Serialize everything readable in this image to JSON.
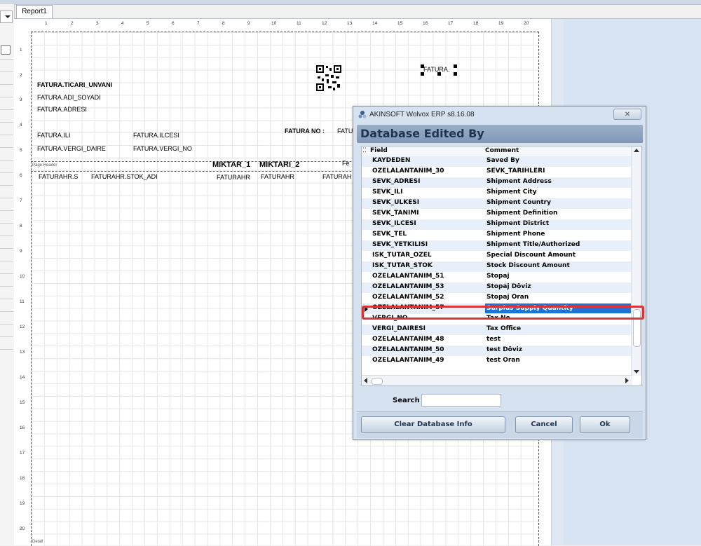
{
  "tab": {
    "label": "Report1"
  },
  "ruler": {
    "h": [
      "1",
      "2",
      "3",
      "4",
      "5",
      "6",
      "7",
      "8",
      "9",
      "10",
      "11",
      "12",
      "13",
      "14",
      "15",
      "16",
      "17",
      "18",
      "19",
      "20"
    ],
    "v": [
      "1",
      "2",
      "3",
      "4",
      "5",
      "6",
      "7",
      "8",
      "9",
      "10",
      "11",
      "12",
      "13",
      "14",
      "15",
      "16",
      "17",
      "18",
      "19",
      "20"
    ]
  },
  "report": {
    "ticari_unvani": "FATURA.TICARI_UNVANI",
    "adi_soyadi": "FATURA.ADI_SOYADI",
    "adresi": "FATURA.ADRESI",
    "ili": "FATURA.ILI",
    "ilcesi": "FATURA.ILCESI",
    "vergi_daire": "FATURA.VERGI_DAIRE",
    "vergi_no": "FATURA.VERGI_NO",
    "fatura_no_label": "FATURA NO :",
    "fatura_no_value": "FATU",
    "fatura_top": "FATURA.",
    "page_header": "Page Header",
    "miktar_1": "MIKTAR_1",
    "miktari_2": "MIKTARI_2",
    "header_cut": "Fe",
    "detail_s": "FATURAHR.S",
    "detail_stok_adi": "FATURAHR.STOK_ADI",
    "detail_3": "FATURAHR",
    "detail_4": "FATURAHR",
    "detail_5": "FATURAH",
    "detail_band": "Detail"
  },
  "dialog": {
    "title": "AKINSOFT Wolvox ERP s8.16.08",
    "close_label": "✕",
    "header": "Database Edited By",
    "columns": {
      "field": "Field",
      "comment": "Comment"
    },
    "rows": [
      {
        "field": "KAYDEDEN",
        "comment": "Saved By"
      },
      {
        "field": "OZELALANTANIM_30",
        "comment": "SEVK_TARIHLERI"
      },
      {
        "field": "SEVK_ADRESI",
        "comment": "Shipment Address"
      },
      {
        "field": "SEVK_ILI",
        "comment": "Shipment City"
      },
      {
        "field": "SEVK_ULKESI",
        "comment": "Shipment Country"
      },
      {
        "field": "SEVK_TANIMI",
        "comment": "Shipment Definition"
      },
      {
        "field": "SEVK_ILCESI",
        "comment": "Shipment District"
      },
      {
        "field": "SEVK_TEL",
        "comment": "Shipment Phone"
      },
      {
        "field": "SEVK_YETKILISI",
        "comment": "Shipment Title/Authorized"
      },
      {
        "field": "ISK_TUTAR_OZEL",
        "comment": "Special Discount Amount"
      },
      {
        "field": "ISK_TUTAR_STOK",
        "comment": "Stock Discount Amount"
      },
      {
        "field": "OZELALANTANIM_51",
        "comment": "Stopaj"
      },
      {
        "field": "OZELALANTANIM_53",
        "comment": "Stopaj Döviz"
      },
      {
        "field": "OZELALANTANIM_52",
        "comment": "Stopaj Oran"
      },
      {
        "field": "OZELALANTANIM_57",
        "comment": "Surplus Supply Quantity"
      },
      {
        "field": "VERGI_NO",
        "comment": "Tax No"
      },
      {
        "field": "VERGI_DAIRESI",
        "comment": "Tax Office"
      },
      {
        "field": "OZELALANTANIM_48",
        "comment": "test"
      },
      {
        "field": "OZELALANTANIM_50",
        "comment": "test Döviz"
      },
      {
        "field": "OZELALANTANIM_49",
        "comment": "test Oran"
      }
    ],
    "selected_row": 14,
    "search_label": "Search",
    "search_value": "",
    "buttons": {
      "clear": "Clear Database Info",
      "cancel": "Cancel",
      "ok": "Ok"
    },
    "colors": {
      "selection": "#1c74d6",
      "highlight_border": "#d9343a",
      "alt_row": "#e7f0fa"
    }
  }
}
